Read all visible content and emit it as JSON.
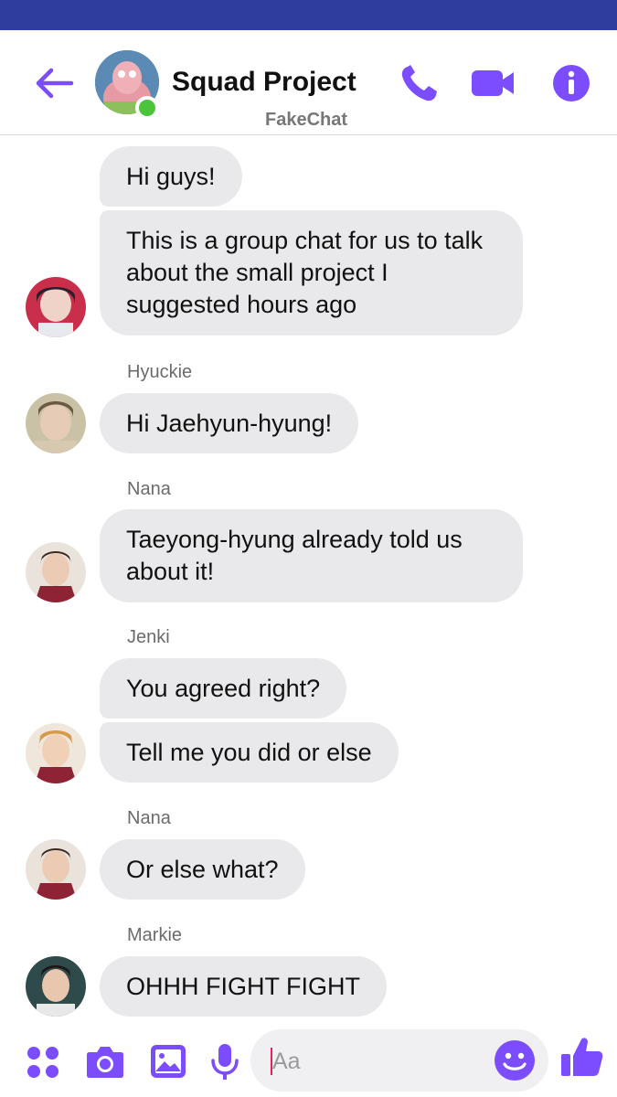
{
  "header": {
    "title": "Squad Project",
    "subtitle": "FakeChat"
  },
  "icons": {
    "back": "arrow-left-icon",
    "call": "phone-icon",
    "video": "video-camera-icon",
    "info": "info-icon",
    "apps": "four-dots-icon",
    "camera": "camera-icon",
    "gallery": "image-icon",
    "mic": "microphone-icon",
    "emoji": "smiley-icon",
    "like": "thumbs-up-icon"
  },
  "colors": {
    "accent": "#7b4dff",
    "status_bar": "#2f3e9e",
    "bubble": "#e9e9eb",
    "online": "#4bc33a"
  },
  "messages": [
    {
      "text": "Hi guys!"
    },
    {
      "text": "This is a group chat for us to talk about the small project I suggested hours ago"
    },
    {
      "sender": "Hyuckie",
      "text": "Hi Jaehyun-hyung!"
    },
    {
      "sender": "Nana",
      "text": "Taeyong-hyung already told us about it!"
    },
    {
      "sender": "Jenki",
      "text": "You agreed right?"
    },
    {
      "text": "Tell me you did or else"
    },
    {
      "sender": "Nana",
      "text": "Or else what?"
    },
    {
      "sender": "Markie",
      "text": "OHHH FIGHT FIGHT"
    }
  ],
  "composer": {
    "placeholder": "Aa"
  }
}
